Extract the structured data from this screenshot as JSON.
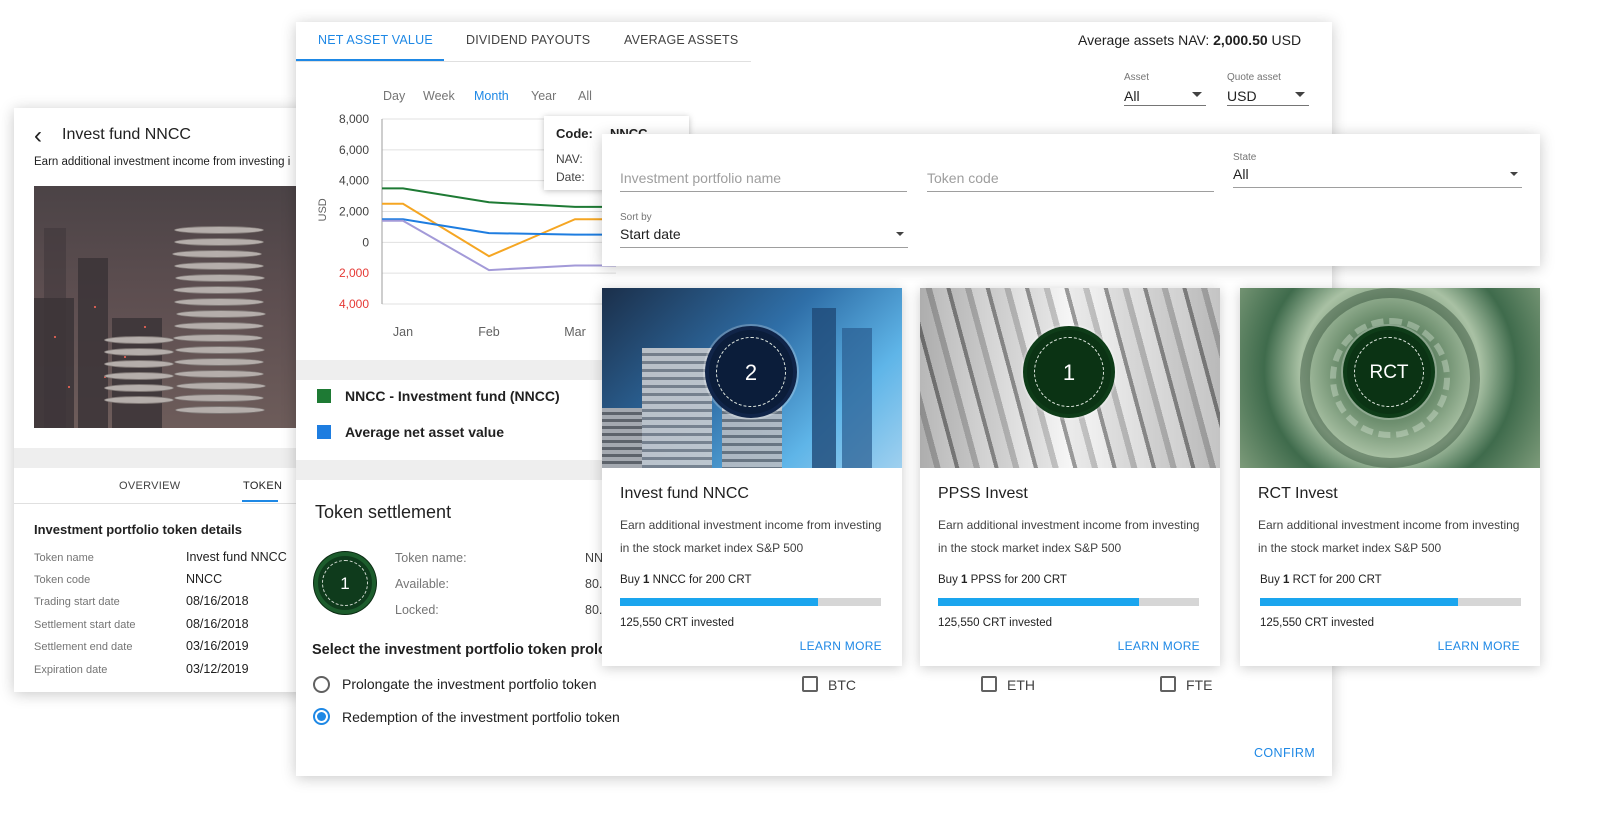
{
  "left_panel": {
    "title": "Invest fund NNCC",
    "subtitle": "Earn additional investment income from investing i",
    "tabs": [
      "OVERVIEW",
      "TOKEN"
    ],
    "active_tab": "TOKEN",
    "details_title": "Investment portfolio token details",
    "details": [
      {
        "label": "Token name",
        "value": "Invest fund NNCC"
      },
      {
        "label": "Token code",
        "value": "NNCC"
      },
      {
        "label": "Trading start date",
        "value": "08/16/2018"
      },
      {
        "label": "Settlement start date",
        "value": "08/16/2018"
      },
      {
        "label": "Settlement end date",
        "value": "03/16/2019"
      },
      {
        "label": "Expiration date",
        "value": "03/12/2019"
      }
    ]
  },
  "main_panel": {
    "tabs": [
      "NET ASSET VALUE",
      "DIVIDEND PAYOUTS",
      "AVERAGE ASSETS"
    ],
    "active_tab": "NET ASSET VALUE",
    "nav_summary": {
      "prefix": "Average assets NAV:",
      "value": "2,000.50",
      "currency": "USD"
    },
    "asset_select": {
      "label": "Asset",
      "value": "All"
    },
    "quote_select": {
      "label": "Quote asset",
      "value": "USD"
    },
    "periods": [
      "Day",
      "Week",
      "Month",
      "Year",
      "All"
    ],
    "active_period": "Month",
    "tooltip": {
      "code_label": "Code:",
      "code_value": "NNCC",
      "nav_label": "NAV:",
      "date_label": "Date:"
    },
    "legend": [
      {
        "label": "NNCC - Investment fund (NNCC)",
        "color": "#1e7a34"
      },
      {
        "label": "Average net asset value",
        "color": "#1e7de0"
      }
    ],
    "token_settlement": {
      "title": "Token settlement",
      "badge": "1",
      "rows": [
        {
          "label": "Token name:",
          "value": "NN"
        },
        {
          "label": "Available:",
          "value": "80."
        },
        {
          "label": "Locked:",
          "value": "80."
        }
      ]
    },
    "prolong_question": "Select the investment portfolio token prolo",
    "options": [
      {
        "label": "Prolongate the investment portfolio token",
        "checked": false
      },
      {
        "label": "Redemption of the investment portfolio token",
        "checked": true
      }
    ],
    "currencies": [
      "BTC",
      "ETH",
      "FTE"
    ],
    "confirm_label": "CONFIRM"
  },
  "chart_data": {
    "type": "line",
    "x": [
      "Jan",
      "Feb",
      "Mar"
    ],
    "ylabel": "USD",
    "yticks": [
      "8,000",
      "6,000",
      "4,000",
      "2,000",
      "0",
      "2,000",
      "4,000"
    ],
    "ylim": [
      -4000,
      8000
    ],
    "grid": true,
    "series": [
      {
        "color": "#1e7a34",
        "values": [
          3500,
          2600,
          2300
        ]
      },
      {
        "color": "#f5a623",
        "values": [
          2500,
          -900,
          1500
        ]
      },
      {
        "color": "#1e7de0",
        "values": [
          1500,
          600,
          500
        ]
      },
      {
        "color": "#a39ad8",
        "values": [
          1400,
          -1800,
          -1500
        ]
      }
    ]
  },
  "filters": {
    "name_placeholder": "Investment portfolio name",
    "code_placeholder": "Token code",
    "state_label": "State",
    "state_value": "All",
    "sort_label": "Sort by",
    "sort_value": "Start date"
  },
  "portfolio_cards": [
    {
      "badge": "2",
      "name": "Invest fund NNCC",
      "description": "Earn additional investment income from investing in the stock market index S&P 500",
      "buy_prefix": "Buy",
      "buy_qty": "1",
      "buy_suffix": "NNCC for 200 CRT",
      "progress": 0.76,
      "invested": "125,550 CRT invested",
      "learn_more": "LEARN MORE"
    },
    {
      "badge": "1",
      "name": "PPSS Invest",
      "description": "Earn additional investment income from investing in the stock market index S&P 500",
      "buy_prefix": "Buy",
      "buy_qty": "1",
      "buy_suffix": "PPSS for 200 CRT",
      "progress": 0.77,
      "invested": "125,550 CRT invested",
      "learn_more": "LEARN MORE"
    },
    {
      "badge": "RCT",
      "name": "RCT Invest",
      "description": "Earn additional investment income from investing in the stock market index S&P 500",
      "buy_prefix": "Buy",
      "buy_qty": "1",
      "buy_suffix": "RCT for 200 CRT",
      "progress": 0.76,
      "invested": "125,550 CRT invested",
      "learn_more": "LEARN MORE"
    }
  ]
}
